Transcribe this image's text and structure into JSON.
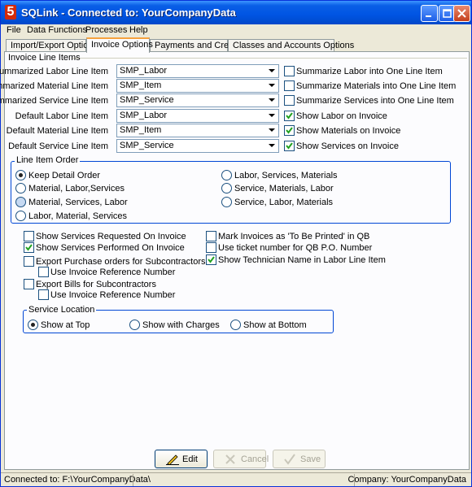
{
  "window": {
    "title": "SQLink - Connected to: YourCompanyData",
    "app_icon_glyph": "5"
  },
  "menu": [
    "File",
    "Data Functions",
    "Processes",
    "Help"
  ],
  "tabs": [
    "Import/Export Options",
    "Invoice Options",
    "Payments and Credits",
    "Classes and Accounts Options"
  ],
  "invoice_line_items": {
    "group_title": "Invoice Line Items",
    "rows": [
      {
        "label": "Summarized Labor Line Item",
        "value": "SMP_Labor",
        "check_label": "Summarize Labor into One Line Item",
        "checked": false
      },
      {
        "label": "Summarized Material Line Item",
        "value": "SMP_Item",
        "check_label": "Summarize Materials into One Line Item",
        "checked": false
      },
      {
        "label": "Summarized Service Line Item",
        "value": "SMP_Service",
        "check_label": "Summarize Services into One Line Item",
        "checked": false
      },
      {
        "label": "Default Labor Line Item",
        "value": "SMP_Labor",
        "check_label": "Show Labor on Invoice",
        "checked": true
      },
      {
        "label": "Default Material Line Item",
        "value": "SMP_Item",
        "check_label": "Show Materials on Invoice",
        "checked": true
      },
      {
        "label": "Default Service Line Item",
        "value": "SMP_Service",
        "check_label": "Show Services on Invoice",
        "checked": true
      }
    ]
  },
  "line_item_order": {
    "group_title": "Line Item Order",
    "options": [
      {
        "label": "Keep Detail Order",
        "selected": true
      },
      {
        "label": "Material, Labor,Services",
        "selected": false
      },
      {
        "label": "Material, Services, Labor",
        "selected": false
      },
      {
        "label": "Labor, Material, Services",
        "selected": false
      },
      {
        "label": "Labor, Services, Materials",
        "selected": false
      },
      {
        "label": "Service, Materials, Labor",
        "selected": false
      },
      {
        "label": "Service, Labor, Materials",
        "selected": false
      }
    ]
  },
  "options_left": [
    {
      "label": "Show Services Requested On Invoice",
      "checked": false
    },
    {
      "label": "Show Services Performed On Invoice",
      "checked": true
    },
    {
      "label": "Export Purchase orders for Subcontractors",
      "checked": false
    },
    {
      "label": "Use Invoice Reference Number",
      "checked": false
    },
    {
      "label": "Export Bills for Subcontractors",
      "checked": false
    },
    {
      "label": "Use Invoice Reference Number",
      "checked": false
    }
  ],
  "options_right": [
    {
      "label": "Mark Invoices as 'To Be Printed' in QB",
      "checked": false
    },
    {
      "label": "Use ticket number for QB P.O. Number",
      "checked": false
    },
    {
      "label": "Show Technician Name in Labor Line Item",
      "checked": true
    }
  ],
  "service_location": {
    "group_title": "Service Location",
    "options": [
      {
        "label": "Show at Top",
        "selected": true
      },
      {
        "label": "Show with Charges",
        "selected": false
      },
      {
        "label": "Show at Bottom",
        "selected": false
      }
    ]
  },
  "buttons": {
    "edit": "Edit",
    "cancel": "Cancel",
    "save": "Save"
  },
  "status": {
    "connected": "Connected to: F:\\YourCompanyData\\",
    "company": "Company: YourCompanyData"
  }
}
